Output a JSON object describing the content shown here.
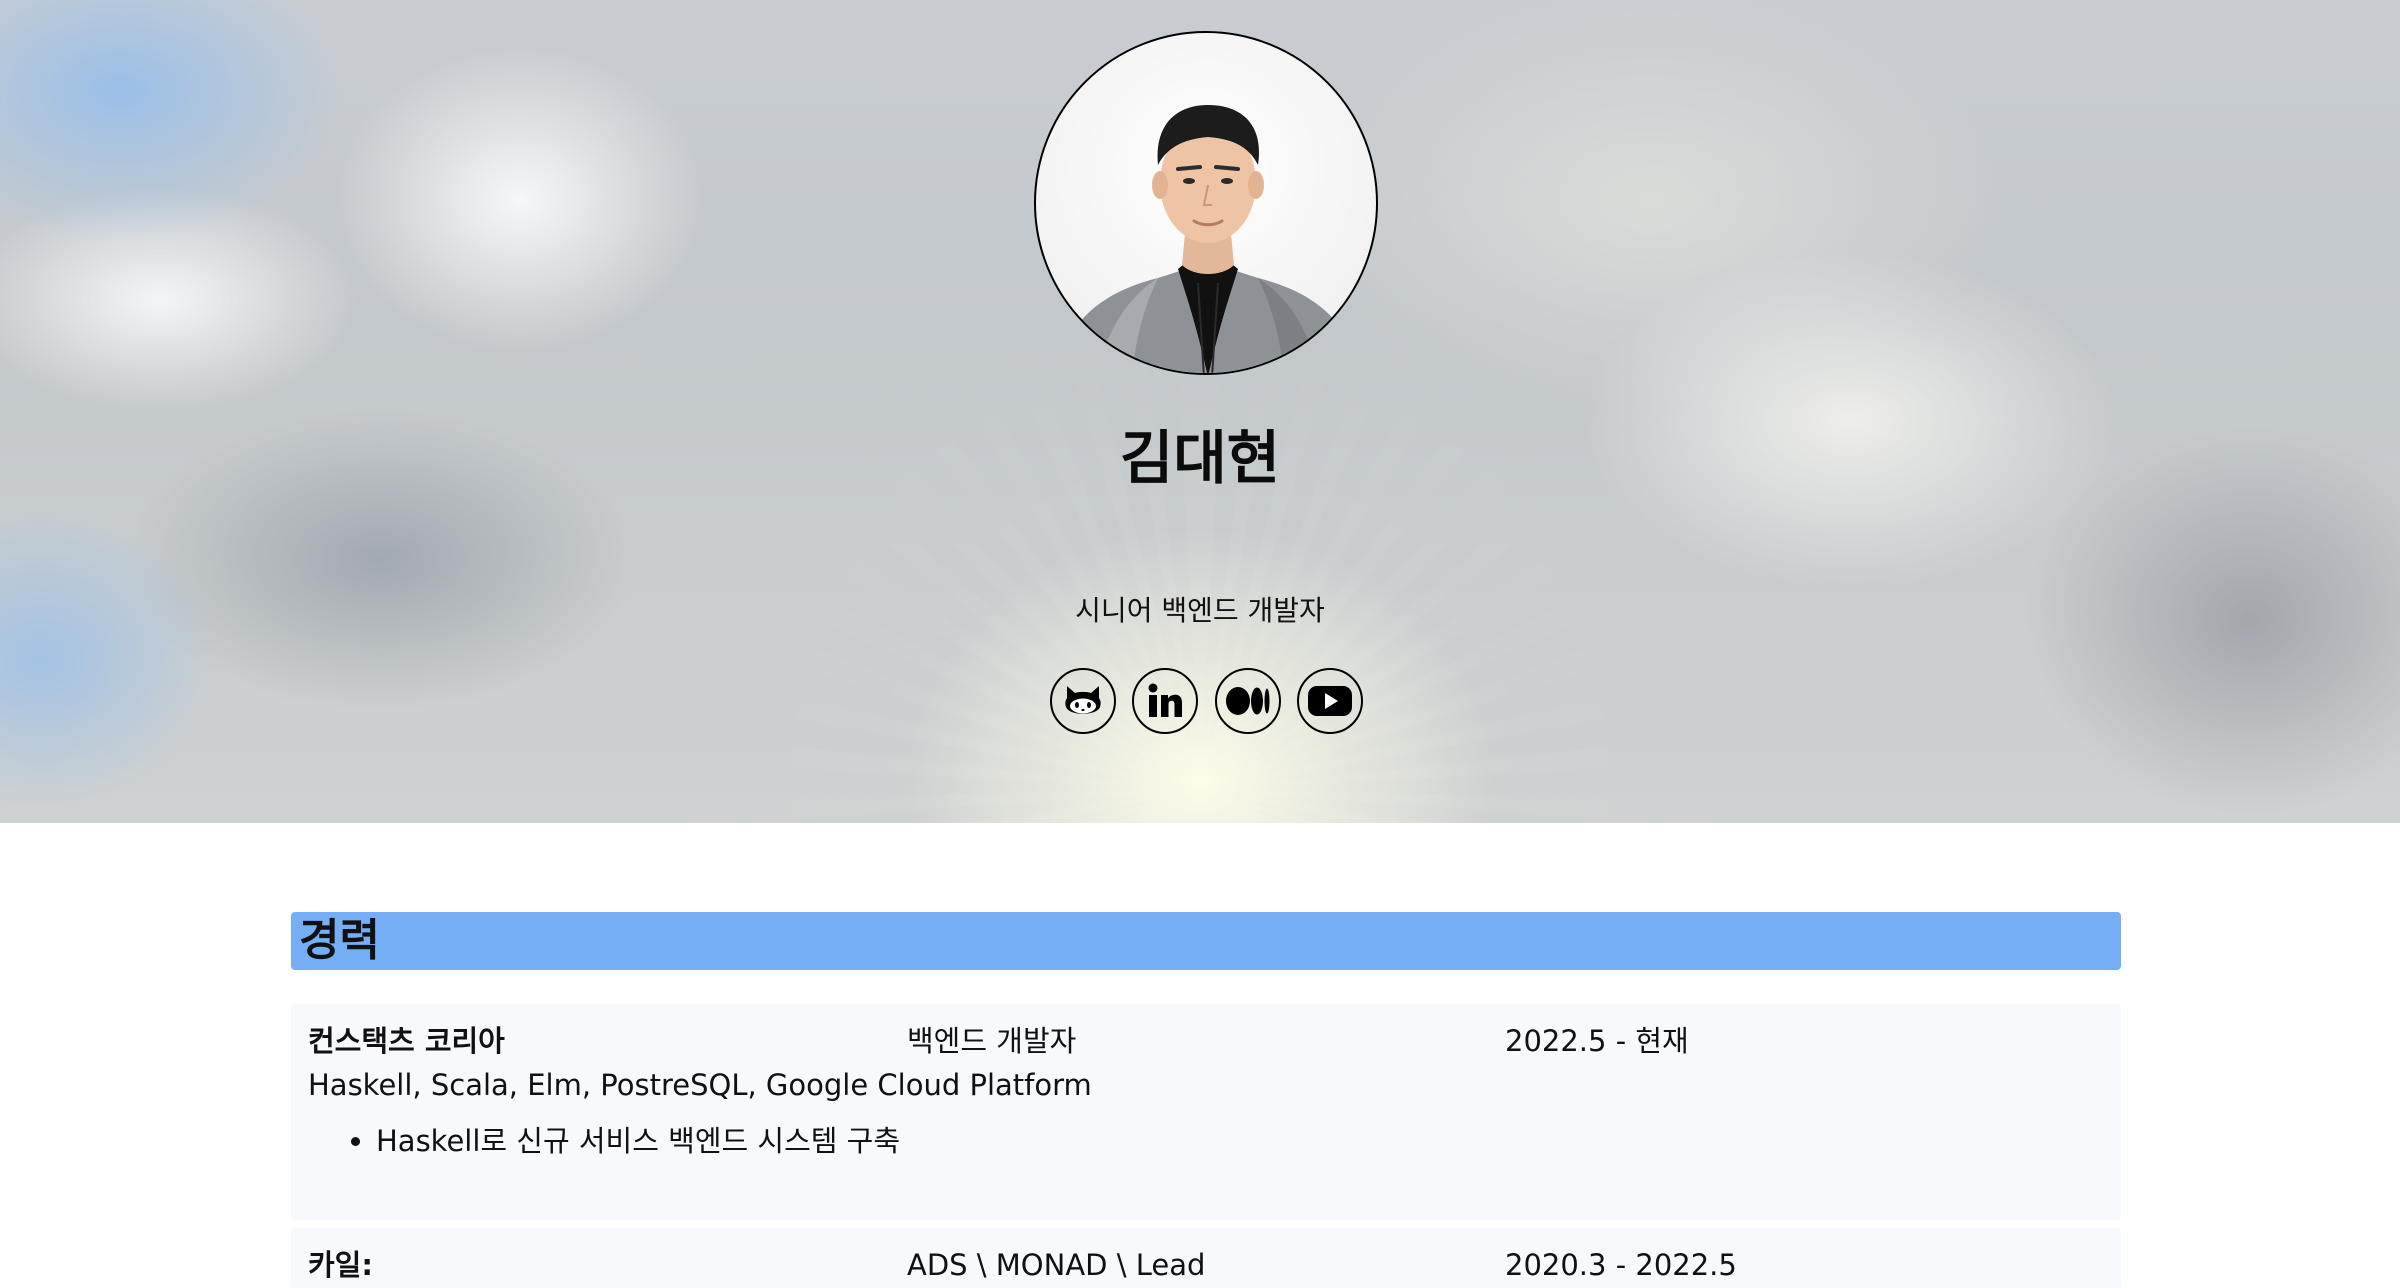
{
  "profile": {
    "name": "김대현",
    "tagline": "시니어 백엔드 개발자"
  },
  "socials": [
    {
      "icon": "github-icon",
      "label": "GitHub"
    },
    {
      "icon": "linkedin-icon",
      "label": "LinkedIn"
    },
    {
      "icon": "medium-icon",
      "label": "Medium"
    },
    {
      "icon": "youtube-icon",
      "label": "YouTube"
    }
  ],
  "colors": {
    "section_bar": "#76aef5",
    "card_bg": "#f7f9fd"
  },
  "career": {
    "title": "경력",
    "jobs": [
      {
        "company": "컨스택츠 코리아",
        "role": "백엔드 개발자",
        "period": "2022.5 - 현재",
        "stack": "Haskell, Scala, Elm, PostreSQL, Google Cloud Platform",
        "bullets": [
          "Haskell로 신규 서비스 백엔드 시스템 구축"
        ]
      },
      {
        "company": "카일:",
        "role": "ADS \\ MONAD \\ Lead",
        "period": "2020.3 - 2022.5"
      }
    ]
  }
}
